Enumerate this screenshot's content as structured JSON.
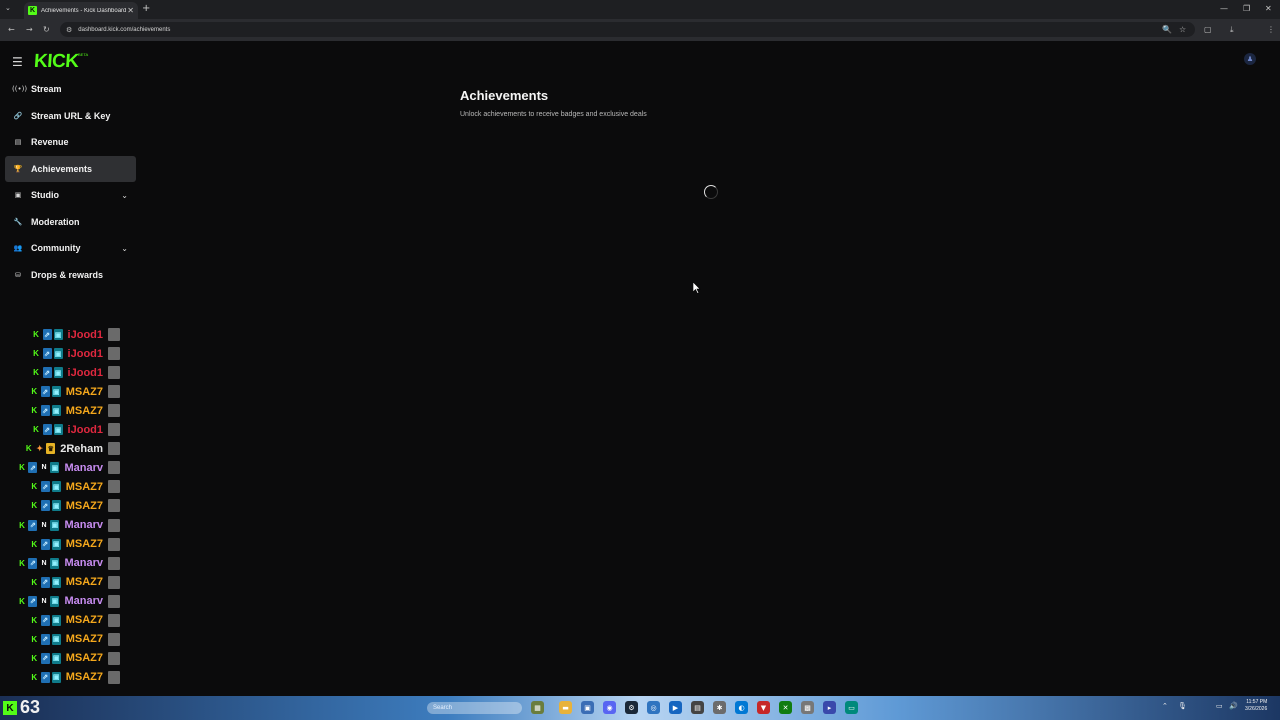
{
  "browser": {
    "tab_title": "Achievements - Kick Dashboard",
    "tab_close": "✕",
    "new_tab": "+",
    "url": "dashboard.kick.com/achievements",
    "window_controls": [
      "—",
      "❐",
      "✕"
    ]
  },
  "app": {
    "logo": "KICK",
    "logo_sup": "BETA",
    "brand_color": "#53fc18"
  },
  "sidebar": {
    "items": [
      {
        "label": "Stream",
        "icon": "broadcast-icon",
        "glyph": "((•))",
        "active": false,
        "expandable": false
      },
      {
        "label": "Stream URL & Key",
        "icon": "link-icon",
        "glyph": "🔗",
        "active": false,
        "expandable": false
      },
      {
        "label": "Revenue",
        "icon": "revenue-icon",
        "glyph": "▤",
        "active": false,
        "expandable": false
      },
      {
        "label": "Achievements",
        "icon": "trophy-icon",
        "glyph": "🏆",
        "active": true,
        "expandable": false
      },
      {
        "label": "Studio",
        "icon": "studio-icon",
        "glyph": "▣",
        "active": false,
        "expandable": true
      },
      {
        "label": "Moderation",
        "icon": "wrench-icon",
        "glyph": "🔧",
        "active": false,
        "expandable": false
      },
      {
        "label": "Community",
        "icon": "community-icon",
        "glyph": "👥",
        "active": false,
        "expandable": true
      },
      {
        "label": "Drops & rewards",
        "icon": "drops-icon",
        "glyph": "⛁",
        "active": false,
        "expandable": false
      }
    ]
  },
  "main": {
    "title": "Achievements",
    "subtitle": "Unlock achievements to receive badges and exclusive deals",
    "loading": true
  },
  "overlay_chat": [
    {
      "name": "iJood1",
      "color": "#e0283f"
    },
    {
      "name": "iJood1",
      "color": "#e0283f"
    },
    {
      "name": "iJood1",
      "color": "#e0283f"
    },
    {
      "name": "MSAZ7",
      "color": "#f5a81c"
    },
    {
      "name": "MSAZ7",
      "color": "#f5a81c"
    },
    {
      "name": "iJood1",
      "color": "#e0283f"
    },
    {
      "name": "2Reham",
      "color": "#e8e8e8"
    },
    {
      "name": "Manarv",
      "color": "#c78cf0"
    },
    {
      "name": "MSAZ7",
      "color": "#f5a81c"
    },
    {
      "name": "MSAZ7",
      "color": "#f5a81c"
    },
    {
      "name": "Manarv",
      "color": "#c78cf0"
    },
    {
      "name": "MSAZ7",
      "color": "#f5a81c"
    },
    {
      "name": "Manarv",
      "color": "#c78cf0"
    },
    {
      "name": "MSAZ7",
      "color": "#f5a81c"
    },
    {
      "name": "Manarv",
      "color": "#c78cf0"
    },
    {
      "name": "MSAZ7",
      "color": "#f5a81c"
    },
    {
      "name": "MSAZ7",
      "color": "#f5a81c"
    },
    {
      "name": "MSAZ7",
      "color": "#f5a81c"
    },
    {
      "name": "MSAZ7",
      "color": "#f5a81c"
    }
  ],
  "taskbar": {
    "counter": "63",
    "search_placeholder": "Search",
    "clock_time": "11:57 PM",
    "clock_date": "3/26/2026"
  }
}
